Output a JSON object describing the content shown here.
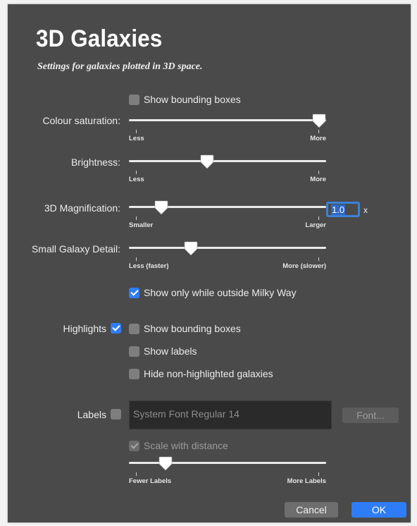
{
  "header": {
    "title": "3D Galaxies",
    "subtitle": "Settings for galaxies plotted in 3D space."
  },
  "bounding_boxes": {
    "label": "Show bounding boxes",
    "checked": false
  },
  "colour_saturation": {
    "label": "Colour saturation:",
    "min_label": "Less",
    "max_label": "More",
    "value": 1.0
  },
  "brightness": {
    "label": "Brightness:",
    "min_label": "Less",
    "max_label": "More",
    "value": 0.39
  },
  "magnification": {
    "label": "3D Magnification:",
    "min_label": "Smaller",
    "max_label": "Larger",
    "value": 0.14,
    "field_value": "1.0",
    "unit": "x"
  },
  "small_galaxy_detail": {
    "label": "Small Galaxy Detail:",
    "min_label": "Less (faster)",
    "max_label": "More (slower)",
    "value": 0.3
  },
  "outside_milky_way": {
    "label": "Show only while outside Milky Way",
    "checked": true
  },
  "highlights": {
    "label": "Highlights",
    "checked": true,
    "options": [
      {
        "label": "Show bounding boxes",
        "checked": false
      },
      {
        "label": "Show labels",
        "checked": false
      },
      {
        "label": "Hide non-highlighted galaxies",
        "checked": false
      }
    ]
  },
  "labels": {
    "label": "Labels",
    "checked": false,
    "font_value": "System Font Regular 14",
    "font_button": "Font...",
    "scale_label": "Scale with distance",
    "scale_checked": true,
    "slider_min_label": "Fewer Labels",
    "slider_max_label": "More Labels",
    "slider_value": 0.16
  },
  "buttons": {
    "cancel": "Cancel",
    "ok": "OK"
  },
  "colors": {
    "accent": "#2f7df6",
    "panel": "#4a4a4b"
  }
}
